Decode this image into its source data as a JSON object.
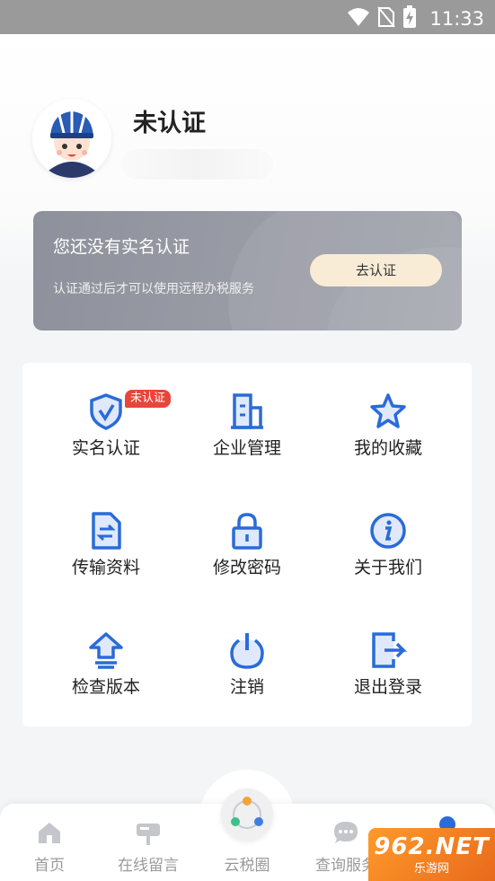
{
  "status_bar": {
    "time": "11:33"
  },
  "profile": {
    "name": "未认证"
  },
  "auth_card": {
    "title": "您还没有实名认证",
    "subtitle": "认证通过后才可以使用远程办税服务",
    "button": "去认证"
  },
  "menu": {
    "items": [
      {
        "label": "实名认证",
        "icon": "shield-verify-icon",
        "badge": "未认证"
      },
      {
        "label": "企业管理",
        "icon": "building-icon"
      },
      {
        "label": "我的收藏",
        "icon": "star-icon"
      },
      {
        "label": "传输资料",
        "icon": "file-transfer-icon"
      },
      {
        "label": "修改密码",
        "icon": "lock-icon"
      },
      {
        "label": "关于我们",
        "icon": "info-icon"
      },
      {
        "label": "检查版本",
        "icon": "upgrade-icon"
      },
      {
        "label": "注销",
        "icon": "power-icon"
      },
      {
        "label": "退出登录",
        "icon": "logout-icon"
      }
    ]
  },
  "tabbar": {
    "tabs": [
      {
        "label": "首页",
        "icon": "home-icon"
      },
      {
        "label": "在线留言",
        "icon": "mailbox-icon"
      },
      {
        "label": "云税圈",
        "icon": "share-circle-icon"
      },
      {
        "label": "查询服务",
        "icon": "chat-icon"
      }
    ]
  },
  "watermark": {
    "line1": "962.NET",
    "line2": "乐游网"
  },
  "colors": {
    "accent": "#2a6bd9",
    "badge": "#e8463a",
    "card": "#9a9ca6",
    "button": "#f8ecd6"
  }
}
